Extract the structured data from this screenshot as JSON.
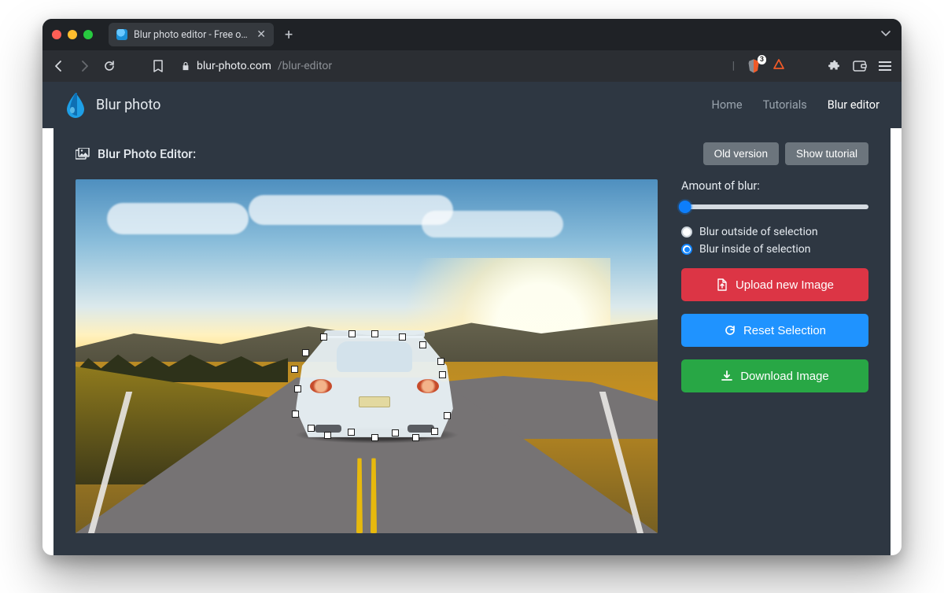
{
  "browser": {
    "tab_title": "Blur photo editor - Free online t",
    "url_host": "blur-photo.com",
    "url_path": "/blur-editor",
    "brave_block_count": "3"
  },
  "header": {
    "brand": "Blur photo",
    "nav": {
      "home": "Home",
      "tutorials": "Tutorials",
      "editor": "Blur editor"
    }
  },
  "editor": {
    "title": "Blur Photo Editor:",
    "old_version": "Old version",
    "show_tutorial": "Show tutorial"
  },
  "controls": {
    "amount_label": "Amount of blur:",
    "radio_outside": "Blur outside of selection",
    "radio_inside": "Blur inside of selection",
    "upload": "Upload new Image",
    "reset": "Reset Selection",
    "download": "Download Image"
  }
}
